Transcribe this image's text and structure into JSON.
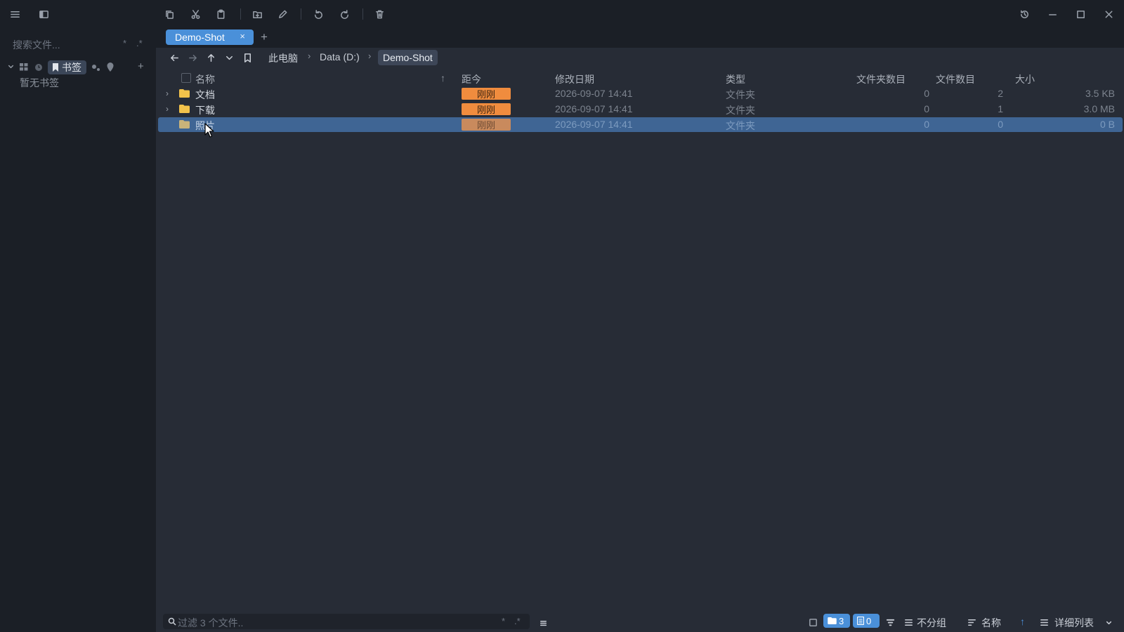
{
  "toolbar": {
    "icons": [
      "menu-icon",
      "sidebar-toggle-icon",
      "copy-icon",
      "cut-icon",
      "paste-icon",
      "new-folder-icon",
      "rename-icon",
      "undo-icon",
      "redo-icon",
      "delete-icon"
    ],
    "window_controls": [
      "history-icon",
      "minimize-icon",
      "maximize-icon",
      "close-icon"
    ]
  },
  "sidebar": {
    "search_placeholder": "搜索文件...",
    "search_opt_star": "*",
    "search_opt_regex": ".*",
    "bookmarks_label": "书签",
    "add_label": "+",
    "empty_text": "暂无书签"
  },
  "tabs": [
    {
      "label": "Demo-Shot",
      "close": "×"
    }
  ],
  "tab_add": "+",
  "breadcrumb": {
    "items": [
      "此电脑",
      "Data (D:)",
      "Demo-Shot"
    ],
    "sep": "›"
  },
  "table": {
    "headers": [
      "名称",
      "距今",
      "修改日期",
      "类型",
      "文件夹数目",
      "文件数目",
      "大小"
    ],
    "sort_arrow": "↑",
    "rows": [
      {
        "name": "文档",
        "ago": "刚刚",
        "date": "2026-09-07 14:41",
        "type": "文件夹",
        "folders": "0",
        "files": "2",
        "size": "3.5 KB",
        "expandable": true,
        "selected": false
      },
      {
        "name": "下载",
        "ago": "刚刚",
        "date": "2026-09-07 14:41",
        "type": "文件夹",
        "folders": "0",
        "files": "1",
        "size": "3.0 MB",
        "expandable": true,
        "selected": false
      },
      {
        "name": "照片",
        "ago": "刚刚",
        "date": "2026-09-07 14:41",
        "type": "文件夹",
        "folders": "0",
        "files": "0",
        "size": "0 B",
        "expandable": false,
        "selected": true
      }
    ]
  },
  "statusbar": {
    "filter_placeholder": "过滤 3 个文件..",
    "filter_star": "*",
    "filter_regex": ".*",
    "folder_count": "3",
    "file_count": "0",
    "group_label": "不分组",
    "sort_label": "名称",
    "sort_arrow": "↑",
    "view_label": "详细列表"
  },
  "colors": {
    "accent": "#4a90d9",
    "ago_badge": "#f08c3e",
    "folder": "#f2c24b",
    "selection": "#3f6594"
  }
}
